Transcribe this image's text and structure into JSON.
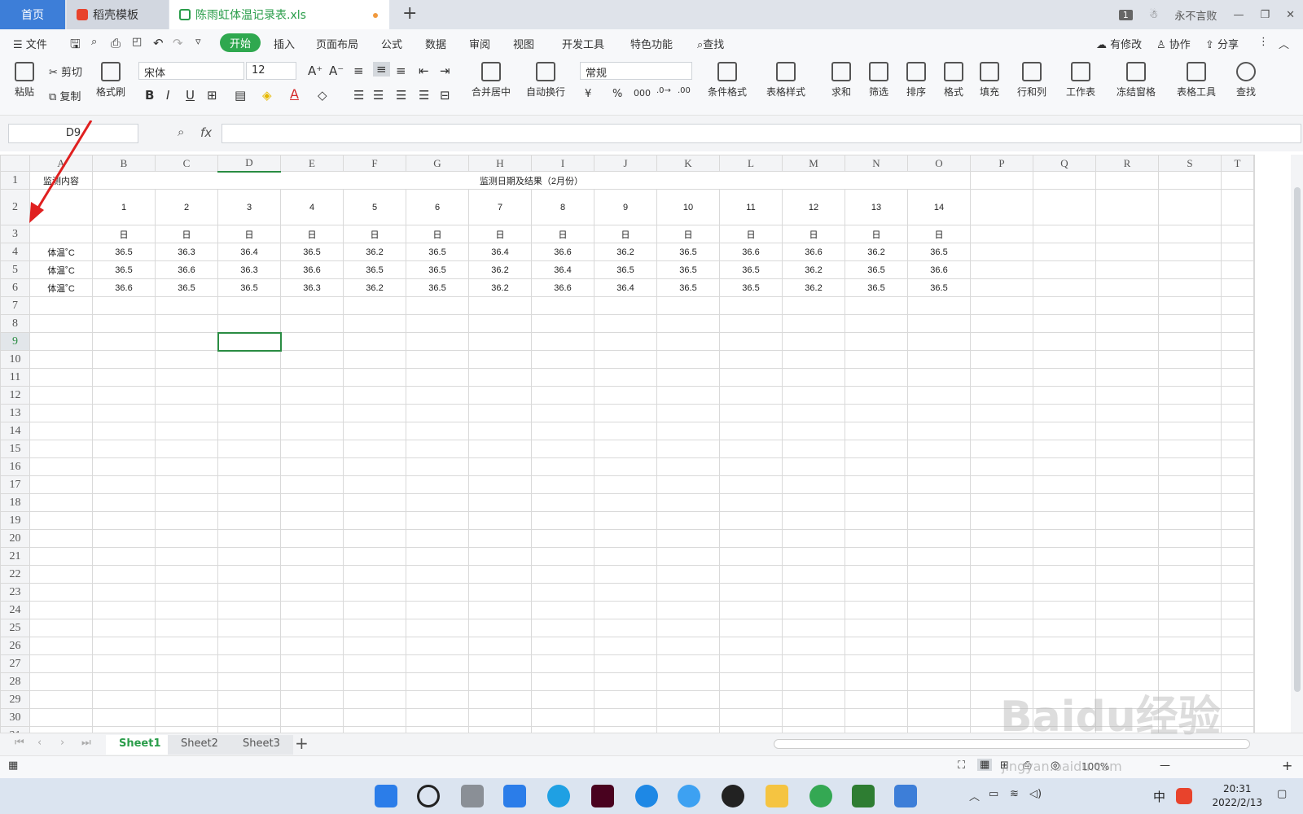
{
  "tabs": {
    "home": "首页",
    "template": "稻壳模板",
    "file": "陈雨虹体温记录表.xls",
    "add": "+"
  },
  "window": {
    "badge": "1",
    "user": "永不言败"
  },
  "menu": {
    "file": "文件",
    "start": "开始",
    "insert": "插入",
    "layout": "页面布局",
    "formula": "公式",
    "data": "数据",
    "review": "审阅",
    "view": "视图",
    "dev": "开发工具",
    "special": "特色功能",
    "search": "查找",
    "modified": "有修改",
    "collab": "协作",
    "share": "分享"
  },
  "ribbon": {
    "paste": "粘贴",
    "cut": "剪切",
    "copy": "复制",
    "format_painter": "格式刷",
    "font_name": "宋体",
    "font_size": "12",
    "merge": "合并居中",
    "wrap": "自动换行",
    "number_format": "常规",
    "cond_format": "条件格式",
    "table_style": "表格样式",
    "sum": "求和",
    "filter": "筛选",
    "sort": "排序",
    "format": "格式",
    "fill": "填充",
    "row_col": "行和列",
    "worksheet": "工作表",
    "freeze": "冻结窗格",
    "table_tools": "表格工具",
    "find": "查找"
  },
  "formula_bar": {
    "cell_ref": "D9",
    "fx": "fx",
    "value": ""
  },
  "sheet": {
    "columns": [
      "A",
      "B",
      "C",
      "D",
      "E",
      "F",
      "G",
      "H",
      "I",
      "J",
      "K",
      "L",
      "M",
      "N",
      "O",
      "P",
      "Q",
      "R",
      "S",
      "T"
    ],
    "title_label": "监测内容",
    "title_merged": "监测日期及结果（2月份）",
    "days": [
      "1",
      "2",
      "3",
      "4",
      "5",
      "6",
      "7",
      "8",
      "9",
      "10",
      "11",
      "12",
      "13",
      "14"
    ],
    "unit_row": [
      "日",
      "日",
      "日",
      "日",
      "日",
      "日",
      "日",
      "日",
      "日",
      "日",
      "日",
      "日",
      "日",
      "日"
    ],
    "row_label": "体温˚C",
    "readings": [
      [
        "36.5",
        "36.3",
        "36.4",
        "36.5",
        "36.2",
        "36.5",
        "36.4",
        "36.6",
        "36.2",
        "36.5",
        "36.6",
        "36.6",
        "36.2",
        "36.5"
      ],
      [
        "36.5",
        "36.6",
        "36.3",
        "36.6",
        "36.5",
        "36.5",
        "36.2",
        "36.4",
        "36.5",
        "36.5",
        "36.5",
        "36.2",
        "36.5",
        "36.6"
      ],
      [
        "36.6",
        "36.5",
        "36.5",
        "36.3",
        "36.2",
        "36.5",
        "36.2",
        "36.6",
        "36.4",
        "36.5",
        "36.5",
        "36.2",
        "36.5",
        "36.5"
      ]
    ],
    "row_count": 31
  },
  "sheets": [
    "Sheet1",
    "Sheet2",
    "Sheet3"
  ],
  "status": {
    "zoom": "100%"
  },
  "taskbar": {
    "ime": "中",
    "time": "20:31",
    "date": "2022/2/13"
  },
  "watermark": {
    "brand": "Baidu经验",
    "url": "jingyan.baidu.com"
  },
  "colors": {
    "accent": "#2fa84f",
    "tab_blue": "#3d7ed8",
    "arrow": "#e02020"
  }
}
